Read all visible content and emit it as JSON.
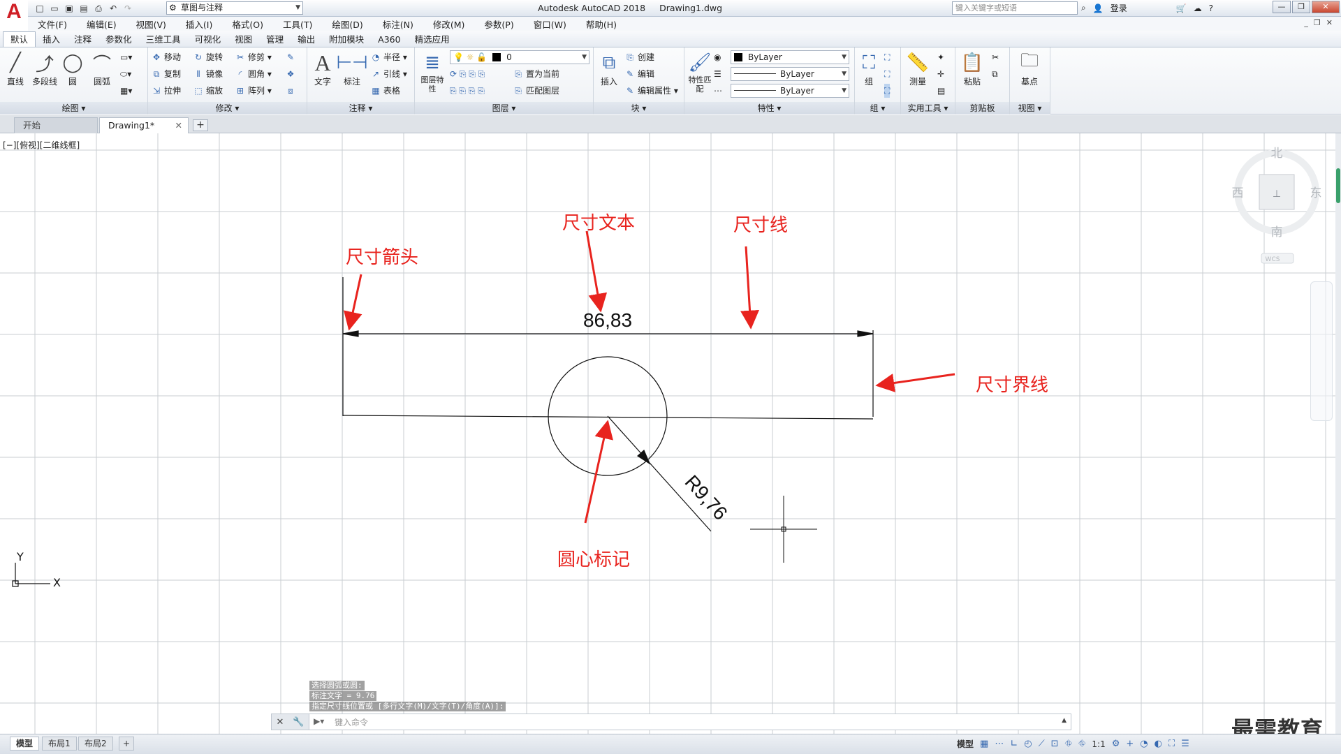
{
  "app": {
    "title": "Autodesk AutoCAD 2018",
    "document": "Drawing1.dwg",
    "workspace": "草图与注释",
    "search_placeholder": "键入关键字或短语",
    "login": "登录",
    "logo": "A"
  },
  "menu": [
    "文件(F)",
    "编辑(E)",
    "视图(V)",
    "插入(I)",
    "格式(O)",
    "工具(T)",
    "绘图(D)",
    "标注(N)",
    "修改(M)",
    "参数(P)",
    "窗口(W)",
    "帮助(H)"
  ],
  "ribbon_tabs": [
    "默认",
    "插入",
    "注释",
    "参数化",
    "三维工具",
    "可视化",
    "视图",
    "管理",
    "输出",
    "附加模块",
    "A360",
    "精选应用"
  ],
  "ribbon": {
    "draw": {
      "title": "绘图",
      "line": "直线",
      "polyline": "多段线",
      "circle": "圆",
      "arc": "圆弧"
    },
    "modify": {
      "title": "修改",
      "move": "移动",
      "rotate": "旋转",
      "trim": "修剪",
      "copy": "复制",
      "mirror": "镜像",
      "fillet": "圆角",
      "stretch": "拉伸",
      "scale": "缩放",
      "array": "阵列"
    },
    "annotation": {
      "title": "注释",
      "text": "文字",
      "dimension": "标注",
      "radius": "半径",
      "leader": "引线",
      "table": "表格"
    },
    "layers": {
      "title": "图层",
      "properties": "图层特性",
      "current_layer": "0",
      "make_current": "置为当前",
      "match": "匹配图层"
    },
    "block": {
      "title": "块",
      "insert": "插入",
      "create": "创建",
      "edit": "编辑",
      "edit_attr": "编辑属性"
    },
    "properties": {
      "title": "特性",
      "match": "特性匹配",
      "color": "ByLayer",
      "linetype": "ByLayer",
      "lineweight": "ByLayer"
    },
    "groups": {
      "title": "组",
      "group": "组"
    },
    "utilities": {
      "title": "实用工具",
      "measure": "测量"
    },
    "clipboard": {
      "title": "剪贴板",
      "paste": "粘贴"
    },
    "view": {
      "title": "视图",
      "base": "基点"
    }
  },
  "doc_tabs": {
    "start": "开始",
    "drawing": "Drawing1*"
  },
  "viewport_label": "[−][俯视][二维线框]",
  "viewcube": {
    "north": "北",
    "south": "南",
    "east": "东",
    "west": "西",
    "wcs": "WCS"
  },
  "drawing": {
    "dim_linear": "86,83",
    "dim_radius": "R9,76",
    "callouts": {
      "arrow": "尺寸箭头",
      "text": "尺寸文本",
      "line": "尺寸线",
      "extension": "尺寸界线",
      "center": "圆心标记"
    },
    "ucs_x": "X",
    "ucs_y": "Y",
    "annotation_color": "#e8231e"
  },
  "command": {
    "history": [
      "选择圆弧或圆:",
      "标注文字 = 9.76",
      "指定尺寸线位置或 [多行文字(M)/文字(T)/角度(A)]:"
    ],
    "placeholder": "键入命令"
  },
  "layout_tabs": [
    "模型",
    "布局1",
    "布局2"
  ],
  "status": {
    "model": "模型",
    "scale": "1:1"
  },
  "watermark": "最需教育"
}
